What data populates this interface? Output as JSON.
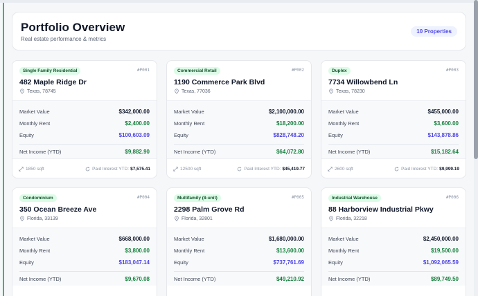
{
  "header": {
    "title": "Portfolio Overview",
    "subtitle": "Real estate performance & metrics",
    "count_badge": "10 Properties"
  },
  "labels": {
    "market_value": "Market Value",
    "monthly_rent": "Monthly Rent",
    "equity": "Equity",
    "net_income": "Net Income (YTD)",
    "paid_interest": "Paid Interest YTD:"
  },
  "colors": {
    "accent_green": "#22c55e",
    "badge_bg": "#dcfce7",
    "indigo": "#4f46e5",
    "green_value": "#15803d"
  },
  "properties": [
    {
      "type": "Single Family Residential",
      "id": "#P001",
      "address": "482 Maple Ridge Dr",
      "location": "Texas, 78745",
      "market_value": "$342,000.00",
      "monthly_rent": "$2,400.00",
      "equity": "$100,603.09",
      "net_income": "$9,882.90",
      "sqft": "1850 sqft",
      "paid_interest": "$7,575.41"
    },
    {
      "type": "Commercial Retail",
      "id": "#P002",
      "address": "1190 Commerce Park Blvd",
      "location": "Texas, 77036",
      "market_value": "$2,100,000.00",
      "monthly_rent": "$18,200.00",
      "equity": "$828,748.20",
      "net_income": "$64,072.80",
      "sqft": "12500 sqft",
      "paid_interest": "$45,419.77"
    },
    {
      "type": "Duplex",
      "id": "#P003",
      "address": "7734 Willowbend Ln",
      "location": "Texas, 78230",
      "market_value": "$455,000.00",
      "monthly_rent": "$3,600.00",
      "equity": "$143,878.86",
      "net_income": "$15,182.64",
      "sqft": "2600 sqft",
      "paid_interest": "$9,999.19"
    },
    {
      "type": "Condominium",
      "id": "#P004",
      "address": "350 Ocean Breeze Ave",
      "location": "Florida, 33139",
      "market_value": "$668,000.00",
      "monthly_rent": "$3,800.00",
      "equity": "$183,047.14",
      "net_income": "$9,670.08"
    },
    {
      "type": "Multifamily (8-unit)",
      "id": "#P005",
      "address": "2298 Palm Grove Rd",
      "location": "Florida, 32801",
      "market_value": "$1,680,000.00",
      "monthly_rent": "$13,600.00",
      "equity": "$737,761.69",
      "net_income": "$49,210.92"
    },
    {
      "type": "Industrial Warehouse",
      "id": "#P006",
      "address": "88 Harborview Industrial Pkwy",
      "location": "Florida, 32218",
      "market_value": "$2,450,000.00",
      "monthly_rent": "$19,500.00",
      "equity": "$1,092,065.59",
      "net_income": "$89,749.50"
    }
  ]
}
